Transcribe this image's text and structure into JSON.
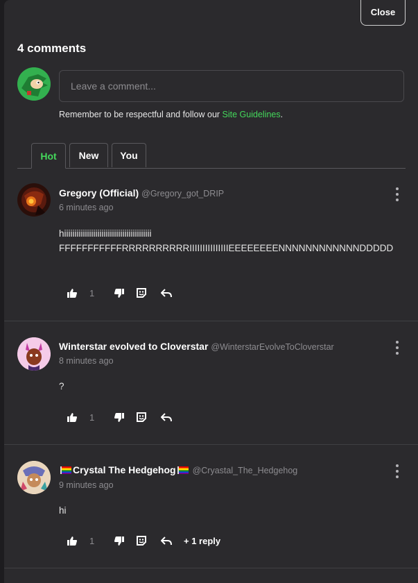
{
  "header": {
    "close_label": "Close",
    "comments_count": "4 comments"
  },
  "composer": {
    "placeholder": "Leave a comment...",
    "guidelines_prefix": "Remember to be respectful and follow our ",
    "guidelines_link": "Site Guidelines",
    "guidelines_suffix": "."
  },
  "tabs": [
    {
      "label": "Hot",
      "active": true
    },
    {
      "label": "New",
      "active": false
    },
    {
      "label": "You",
      "active": false
    }
  ],
  "comments": [
    {
      "name": "Gregory (Official)",
      "handle": "@Gregory_got_DRIP",
      "time": "6 minutes ago",
      "body_lines": [
        "hiiiiiiiiiiiiiiiiiiiiiiiiiiiiiiiiiiiiiiiiii",
        "FFFFFFFFFFFRRRRRRRRRRIIIIIIIIIIIIIIIEEEEEEEENNNNNNNNNNNNDDDDD"
      ],
      "likes": "1"
    },
    {
      "name": "Winterstar evolved to Cloverstar",
      "handle": "@WinterstarEvolveToCloverstar",
      "time": "8 minutes ago",
      "body_lines": [
        "?"
      ],
      "likes": "1"
    },
    {
      "name": "Crystal The Hedgehog",
      "handle": "@Cryastal_The_Hedgehog",
      "time": "9 minutes ago",
      "body_lines": [
        "hi"
      ],
      "likes": "1",
      "replies": "+ 1 reply"
    }
  ],
  "colors": {
    "accent": "#44d85b",
    "panel": "#2b2a2d",
    "muted": "#8d8c90"
  }
}
